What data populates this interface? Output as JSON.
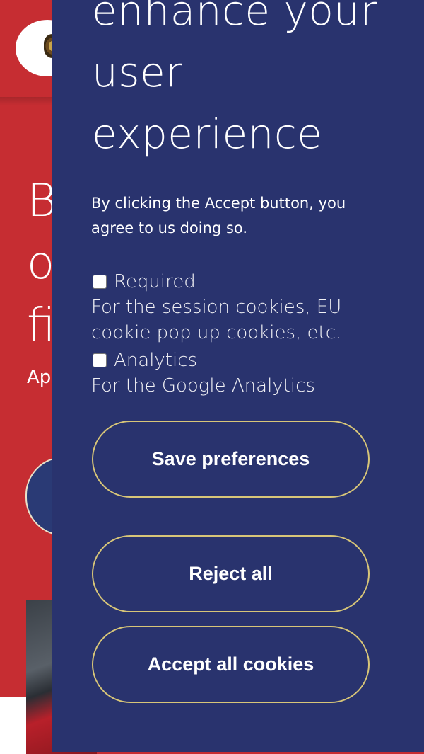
{
  "background": {
    "hero_title_fragment": "B\no\nfi",
    "hero_sub_fragment": "Ap"
  },
  "cookie_panel": {
    "title": "enhance your user experience",
    "description": "By clicking the Accept button, you agree to us doing so.",
    "preferences": [
      {
        "label": "Required",
        "description": "For the session cookies, EU cookie pop up cookies, etc.",
        "checked": false
      },
      {
        "label": "Analytics",
        "description": "For the Google Analytics",
        "checked": false
      }
    ],
    "buttons": {
      "save": "Save preferences",
      "reject": "Reject all",
      "accept": "Accept all cookies"
    }
  },
  "colors": {
    "brand_red": "#c62d32",
    "panel_navy": "#29336e",
    "button_border": "#d8c678"
  }
}
